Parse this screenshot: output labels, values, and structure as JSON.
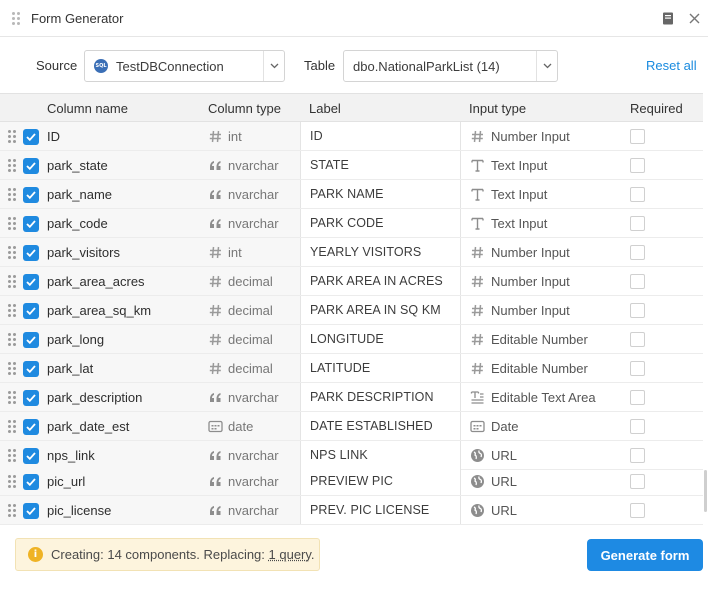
{
  "window": {
    "title": "Form Generator"
  },
  "toolbar": {
    "source_label": "Source",
    "source_value": "TestDBConnection",
    "table_label": "Table",
    "table_value": "dbo.NationalParkList (14)",
    "reset_label": "Reset all"
  },
  "table": {
    "headers": {
      "column_name": "Column name",
      "column_type": "Column type",
      "label": "Label",
      "input_type": "Input type",
      "required": "Required"
    },
    "rows": [
      {
        "name": "ID",
        "type": "int",
        "type_icon": "hash-icon",
        "label": "ID",
        "input": "Number Input",
        "input_icon": "hash-icon",
        "checked": true,
        "required": false
      },
      {
        "name": "park_state",
        "type": "nvarchar",
        "type_icon": "quote-icon",
        "label": "STATE",
        "input": "Text Input",
        "input_icon": "text-icon",
        "checked": true,
        "required": false
      },
      {
        "name": "park_name",
        "type": "nvarchar",
        "type_icon": "quote-icon",
        "label": "PARK NAME",
        "input": "Text Input",
        "input_icon": "text-icon",
        "checked": true,
        "required": false
      },
      {
        "name": "park_code",
        "type": "nvarchar",
        "type_icon": "quote-icon",
        "label": "PARK CODE",
        "input": "Text Input",
        "input_icon": "text-icon",
        "checked": true,
        "required": false
      },
      {
        "name": "park_visitors",
        "type": "int",
        "type_icon": "hash-icon",
        "label": "YEARLY VISITORS",
        "input": "Number Input",
        "input_icon": "hash-icon",
        "checked": true,
        "required": false
      },
      {
        "name": "park_area_acres",
        "type": "decimal",
        "type_icon": "hash-icon",
        "label": "PARK AREA IN ACRES",
        "input": "Number Input",
        "input_icon": "hash-icon",
        "checked": true,
        "required": false
      },
      {
        "name": "park_area_sq_km",
        "type": "decimal",
        "type_icon": "hash-icon",
        "label": "PARK AREA IN SQ KM",
        "input": "Number Input",
        "input_icon": "hash-icon",
        "checked": true,
        "required": false
      },
      {
        "name": "park_long",
        "type": "decimal",
        "type_icon": "hash-icon",
        "label": "LONGITUDE",
        "input": "Editable Number",
        "input_icon": "hash-icon",
        "checked": true,
        "required": false
      },
      {
        "name": "park_lat",
        "type": "decimal",
        "type_icon": "hash-icon",
        "label": "LATITUDE",
        "input": "Editable Number",
        "input_icon": "hash-icon",
        "checked": true,
        "required": false
      },
      {
        "name": "park_description",
        "type": "nvarchar",
        "type_icon": "quote-icon",
        "label": "PARK DESCRIPTION",
        "input": "Editable Text Area",
        "input_icon": "text-area-icon",
        "checked": true,
        "required": false
      },
      {
        "name": "park_date_est",
        "type": "date",
        "type_icon": "calendar-icon",
        "label": "DATE ESTABLISHED",
        "input": "Date",
        "input_icon": "calendar-icon",
        "checked": true,
        "required": false
      },
      {
        "name": "nps_link",
        "type": "nvarchar",
        "type_icon": "quote-icon",
        "label": "NPS LINK",
        "input": "URL",
        "input_icon": "globe-icon",
        "checked": true,
        "required": false
      },
      {
        "name": "pic_url",
        "type": "nvarchar",
        "type_icon": "quote-icon",
        "label": "PREVIEW PIC",
        "input": "URL",
        "input_icon": "globe-icon",
        "checked": true,
        "required": false
      },
      {
        "name": "pic_license",
        "type": "nvarchar",
        "type_icon": "quote-icon",
        "label": "PREV. PIC LICENSE",
        "input": "URL",
        "input_icon": "globe-icon",
        "checked": true,
        "required": false
      }
    ]
  },
  "footer": {
    "notice_prefix": "Creating: 14 components. Replacing: ",
    "notice_link": "1 query",
    "notice_suffix": ".",
    "generate_label": "Generate form"
  },
  "colors": {
    "accent": "#1e8ae3",
    "checkbox": "#1f8ae0",
    "notice_bg": "#fdf4dd",
    "warning": "#efb325"
  }
}
